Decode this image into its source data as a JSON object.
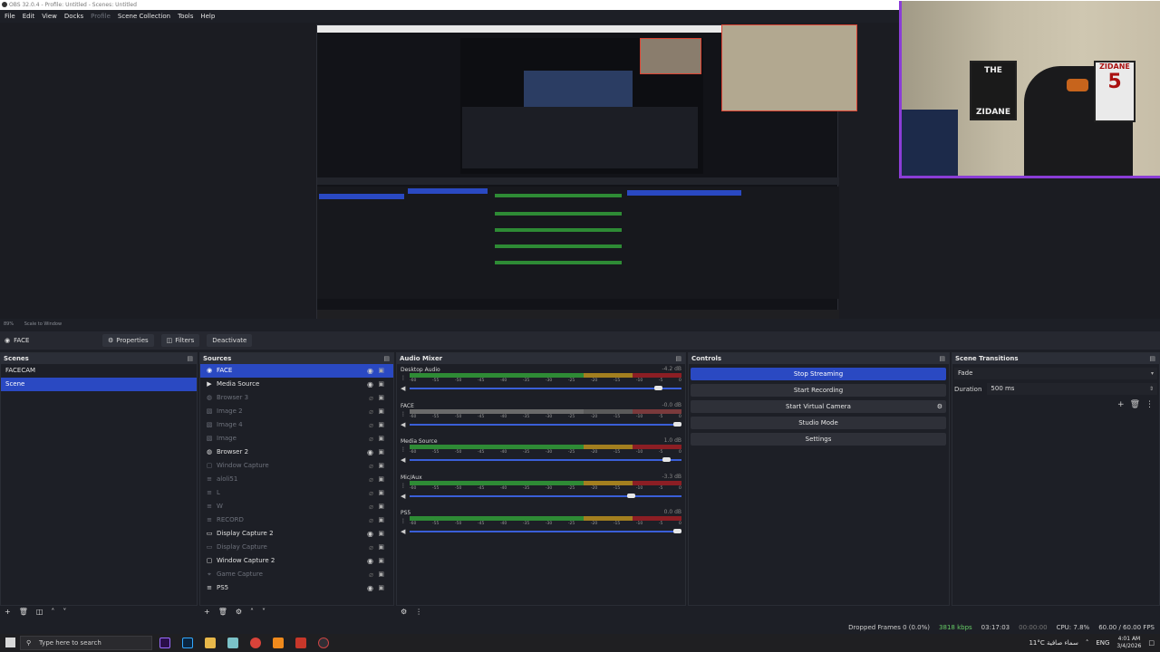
{
  "window": {
    "title": "OBS 32.0.4 - Profile: Untitled - Scenes: Untitled"
  },
  "menu": [
    "File",
    "Edit",
    "View",
    "Docks",
    "Profile",
    "Scene Collection",
    "Tools",
    "Help"
  ],
  "zoom": {
    "level": "89%",
    "mode": "Scale to Window"
  },
  "webcam": {
    "poster1_top": "THE",
    "poster1_bottom": "ZIDANE",
    "poster2_top": "ZIDANE",
    "poster2_number": "5"
  },
  "toolbar": {
    "current_source": "FACE",
    "properties": "Properties",
    "filters": "Filters",
    "deactivate": "Deactivate"
  },
  "scenes": {
    "title": "Scenes",
    "items": [
      {
        "label": "FACECAM",
        "selected": false
      },
      {
        "label": "Scene",
        "selected": true
      }
    ]
  },
  "sources": {
    "title": "Sources",
    "items": [
      {
        "label": "FACE",
        "icon": "camera-icon",
        "visible": true,
        "selected": true
      },
      {
        "label": "Media Source",
        "icon": "play-icon",
        "visible": true
      },
      {
        "label": "Browser 3",
        "icon": "globe-icon",
        "visible": false
      },
      {
        "label": "Image 2",
        "icon": "image-icon",
        "visible": false
      },
      {
        "label": "Image 4",
        "icon": "image-icon",
        "visible": false
      },
      {
        "label": "Image",
        "icon": "image-icon",
        "visible": false
      },
      {
        "label": "Browser 2",
        "icon": "globe-icon",
        "visible": true
      },
      {
        "label": "Window Capture",
        "icon": "window-icon",
        "visible": false
      },
      {
        "label": "aloli51",
        "icon": "group-icon",
        "visible": false
      },
      {
        "label": "L",
        "icon": "group-icon",
        "visible": false
      },
      {
        "label": "W",
        "icon": "group-icon",
        "visible": false
      },
      {
        "label": "RECORD",
        "icon": "group-icon",
        "visible": false
      },
      {
        "label": "Display Capture 2",
        "icon": "monitor-icon",
        "visible": true
      },
      {
        "label": "Display Capture",
        "icon": "monitor-icon",
        "visible": false
      },
      {
        "label": "Window Capture 2",
        "icon": "window-icon",
        "visible": true
      },
      {
        "label": "Game Capture",
        "icon": "gamepad-icon",
        "visible": false
      },
      {
        "label": "PS5",
        "icon": "group-icon",
        "visible": true
      }
    ]
  },
  "mixer": {
    "title": "Audio Mixer",
    "ticks": [
      "-60",
      "-55",
      "-50",
      "-45",
      "-40",
      "-35",
      "-30",
      "-25",
      "-20",
      "-15",
      "-10",
      "-5",
      "0"
    ],
    "channels": [
      {
        "name": "Desktop Audio",
        "db": "-4.2 dB",
        "level": 0.93,
        "active": true
      },
      {
        "name": "FACE",
        "db": "-0.0 dB",
        "level": 1.0,
        "active": false
      },
      {
        "name": "Media Source",
        "db": "1.0 dB",
        "level": 0.96,
        "active": true
      },
      {
        "name": "Mic/Aux",
        "db": "-3.3 dB",
        "level": 0.83,
        "active": true
      },
      {
        "name": "PS5",
        "db": "0.0 dB",
        "level": 1.0,
        "active": true
      }
    ]
  },
  "controls": {
    "title": "Controls",
    "stop_streaming": "Stop Streaming",
    "start_recording": "Start Recording",
    "start_virtual_camera": "Start Virtual Camera",
    "studio_mode": "Studio Mode",
    "settings": "Settings"
  },
  "transitions": {
    "title": "Scene Transitions",
    "type": "Fade",
    "duration_label": "Duration",
    "duration_value": "500 ms"
  },
  "status": {
    "dropped": "Dropped Frames 0 (0.0%)",
    "bitrate": "3818 kbps",
    "stream_time": "03:17:03",
    "rec_time": "00:00:00",
    "cpu": "CPU: 7.8%",
    "fps": "60.00 / 60.00 FPS"
  },
  "taskbar": {
    "search_placeholder": "Type here to search",
    "weather": "11°C سماء صافية",
    "lang": "ENG",
    "time": "4:01 AM",
    "date": "3/4/2026"
  }
}
